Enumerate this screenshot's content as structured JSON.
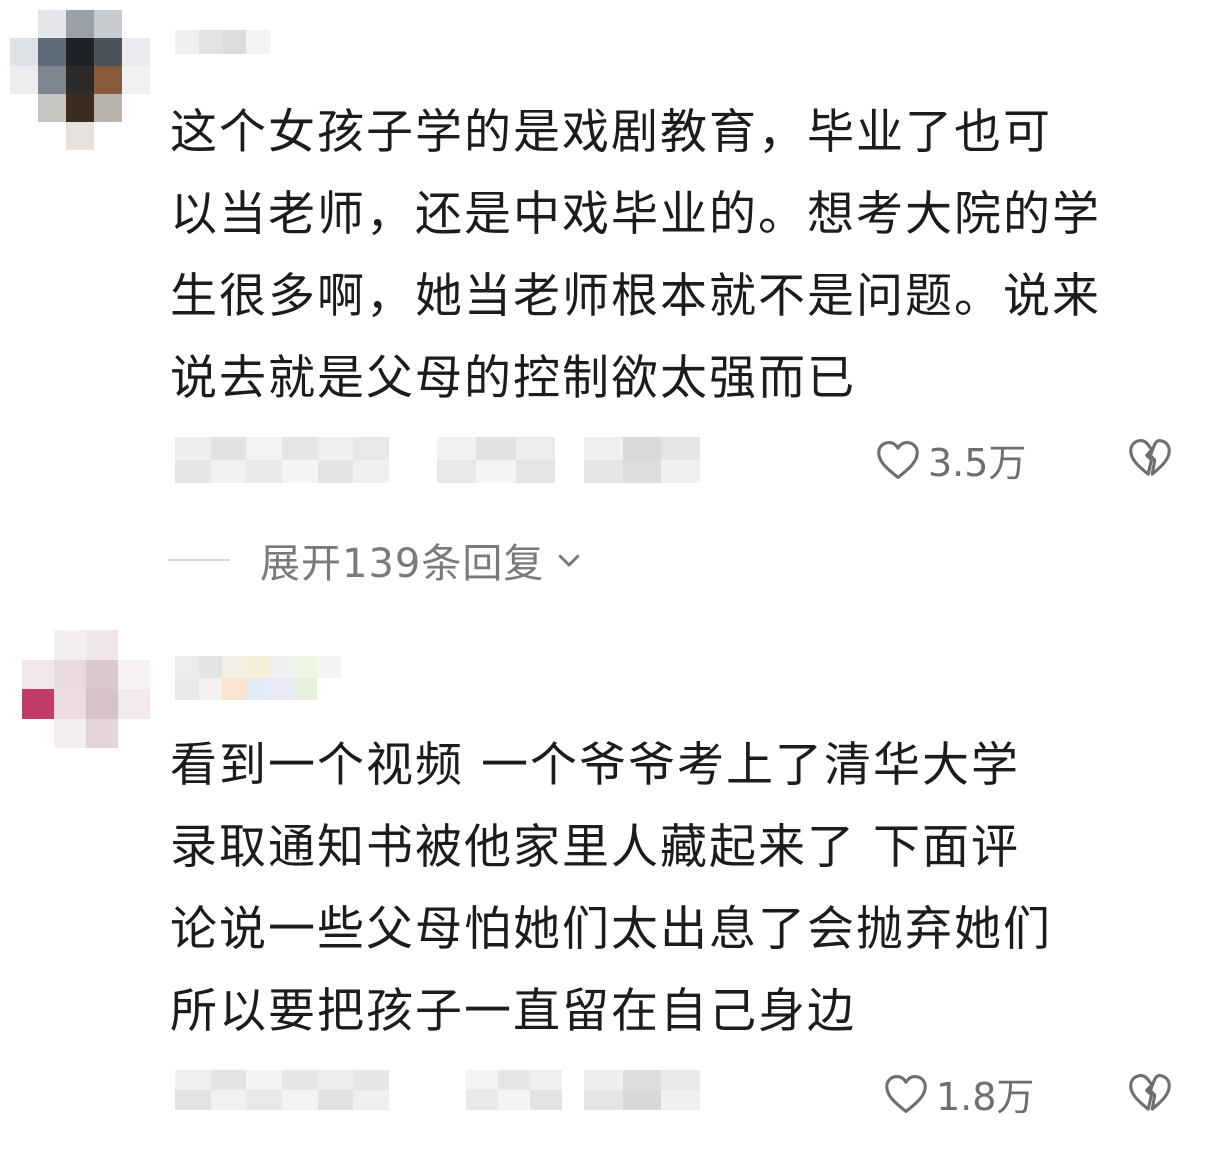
{
  "comments": [
    {
      "text": "这个女孩子学的是戏剧教育，毕业了也可\n以当老师，还是中戏毕业的。想考大院的学\n生很多啊，她当老师根本就不是问题。说来\n说去就是父母的控制欲太强而已",
      "likes": "3.5万"
    },
    {
      "text": "看到一个视频 一个爷爷考上了清华大学\n录取通知书被他家里人藏起来了  下面评\n论说一些父母怕她们太出息了会抛弃她们\n所以要把孩子一直留在自己身边",
      "likes": "1.8万"
    }
  ],
  "expand_replies": {
    "label": "展开139条回复"
  },
  "icons": {
    "like": "heart-outline-icon",
    "dislike": "broken-heart-icon",
    "expand": "chevron-down-icon"
  },
  "colors": {
    "text": "#1c1c1c",
    "meta": "#6f6f6f",
    "expand": "#7a7a7a"
  }
}
